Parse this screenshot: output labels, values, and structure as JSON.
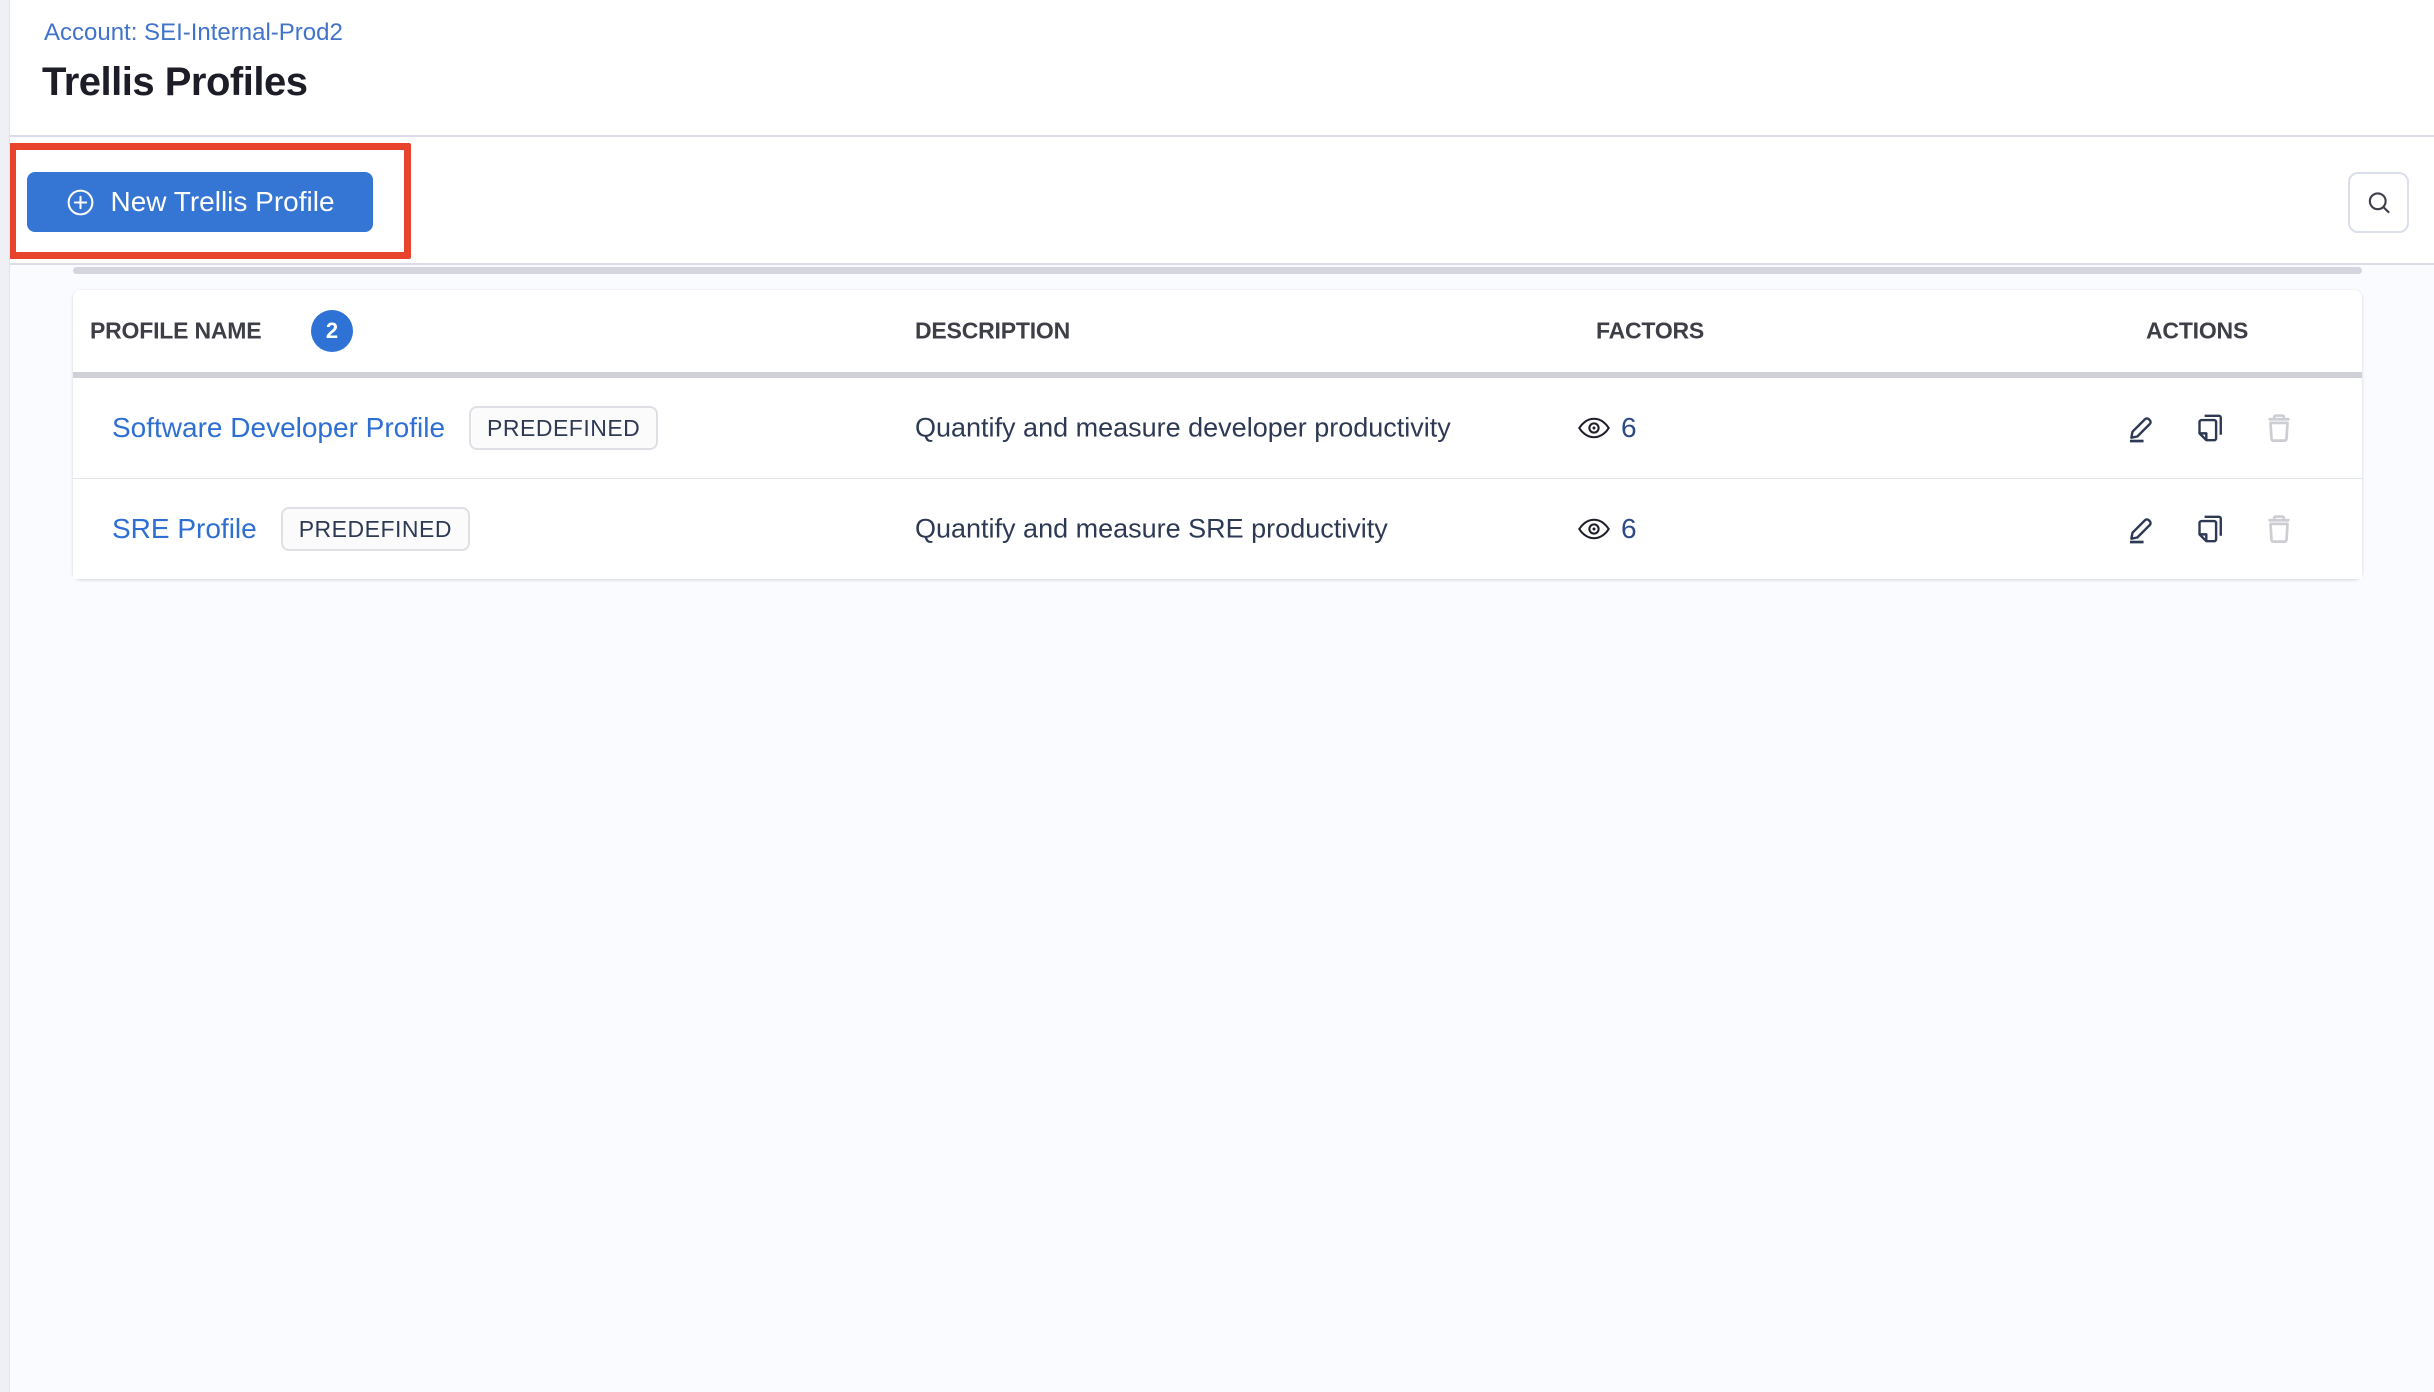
{
  "header": {
    "account_label": "Account: SEI-Internal-Prod2",
    "title": "Trellis Profiles"
  },
  "toolbar": {
    "new_profile_label": "New Trellis Profile",
    "new_profile_icon": "plus-circle-icon",
    "search_icon": "search-icon"
  },
  "annotation": {
    "shape": "red-rectangle-highlight",
    "target": "new-trellis-profile-button"
  },
  "table": {
    "headers": {
      "name": "PROFILE NAME",
      "count": "2",
      "description": "DESCRIPTION",
      "factors": "FACTORS",
      "actions": "ACTIONS"
    },
    "row_icons": [
      "eye-icon",
      "pencil-icon",
      "copy-icon",
      "trash-icon"
    ],
    "rows": [
      {
        "name": "Software Developer Profile",
        "badge": "PREDEFINED",
        "description": "Quantify and measure developer productivity",
        "factors": "6"
      },
      {
        "name": "SRE Profile",
        "badge": "PREDEFINED",
        "description": "Quantify and measure SRE productivity",
        "factors": "6"
      }
    ]
  },
  "colors": {
    "accent": "#3575d3",
    "link": "#2e6fd3",
    "account-link": "#4173ca",
    "annotation": "#e8432d",
    "count-badge": "#2e72d5",
    "text-dark": "#2e3a54",
    "header-text": "#3e3e47",
    "trash": "#cdced3"
  }
}
